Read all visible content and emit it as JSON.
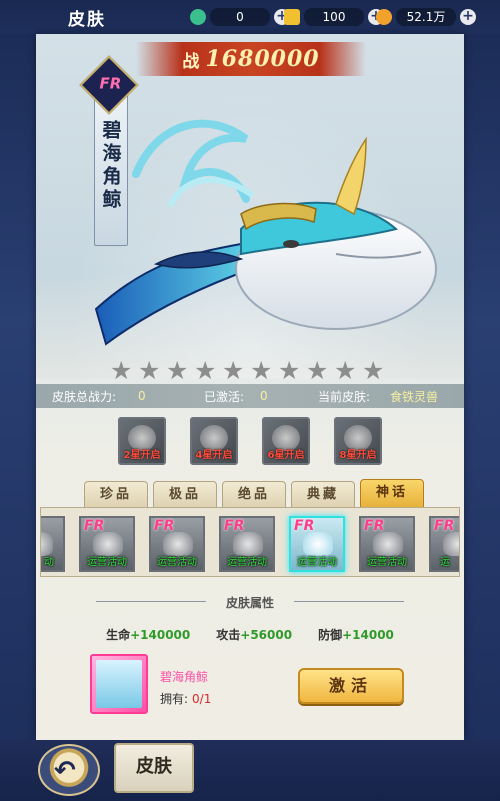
{
  "header": {
    "title": "皮肤",
    "resources": [
      {
        "name": "jade",
        "value": "0",
        "color": "#3bbf8c"
      },
      {
        "name": "gold-ingot",
        "value": "100",
        "color": "#f0c030"
      },
      {
        "name": "coin",
        "value": "52.1万",
        "color": "#f2a12b"
      }
    ]
  },
  "showcase": {
    "power_label": "战",
    "power_value": "1680000",
    "rarity_badge": "FR",
    "skin_name": "碧海角鲸",
    "stars_total": 10,
    "stars_filled": 0
  },
  "stats": {
    "total_power_label": "皮肤总战力:",
    "total_power_value": "0",
    "activated_label": "已激活:",
    "activated_value": "0",
    "current_label": "当前皮肤:",
    "current_value": "食铁灵兽"
  },
  "unlocks": [
    {
      "label": "2星开启"
    },
    {
      "label": "4星开启"
    },
    {
      "label": "6星开启"
    },
    {
      "label": "8星开启"
    }
  ],
  "tabs": [
    {
      "label": "珍品",
      "active": false
    },
    {
      "label": "极品",
      "active": false
    },
    {
      "label": "绝品",
      "active": false
    },
    {
      "label": "典藏",
      "active": false
    },
    {
      "label": "神话",
      "active": true
    }
  ],
  "skins": [
    {
      "badge": "",
      "label": "动"
    },
    {
      "badge": "FR",
      "label": "运营活动"
    },
    {
      "badge": "FR",
      "label": "运营活动"
    },
    {
      "badge": "FR",
      "label": "运营活动"
    },
    {
      "badge": "FR",
      "label": "运营活动",
      "selected": true
    },
    {
      "badge": "FR",
      "label": "运营活动"
    },
    {
      "badge": "FR",
      "label": "运"
    }
  ],
  "attributes": {
    "title": "皮肤属性",
    "items": [
      {
        "key": "生命",
        "value": "+140000"
      },
      {
        "key": "攻击",
        "value": "+56000"
      },
      {
        "key": "防御",
        "value": "+14000"
      }
    ]
  },
  "owned": {
    "name": "碧海角鲸",
    "count_label": "拥有:",
    "count_value": "0/1",
    "activate_label": "激活"
  },
  "footer": {
    "back_icon": "back-arrow-icon",
    "tab_label": "皮肤"
  }
}
